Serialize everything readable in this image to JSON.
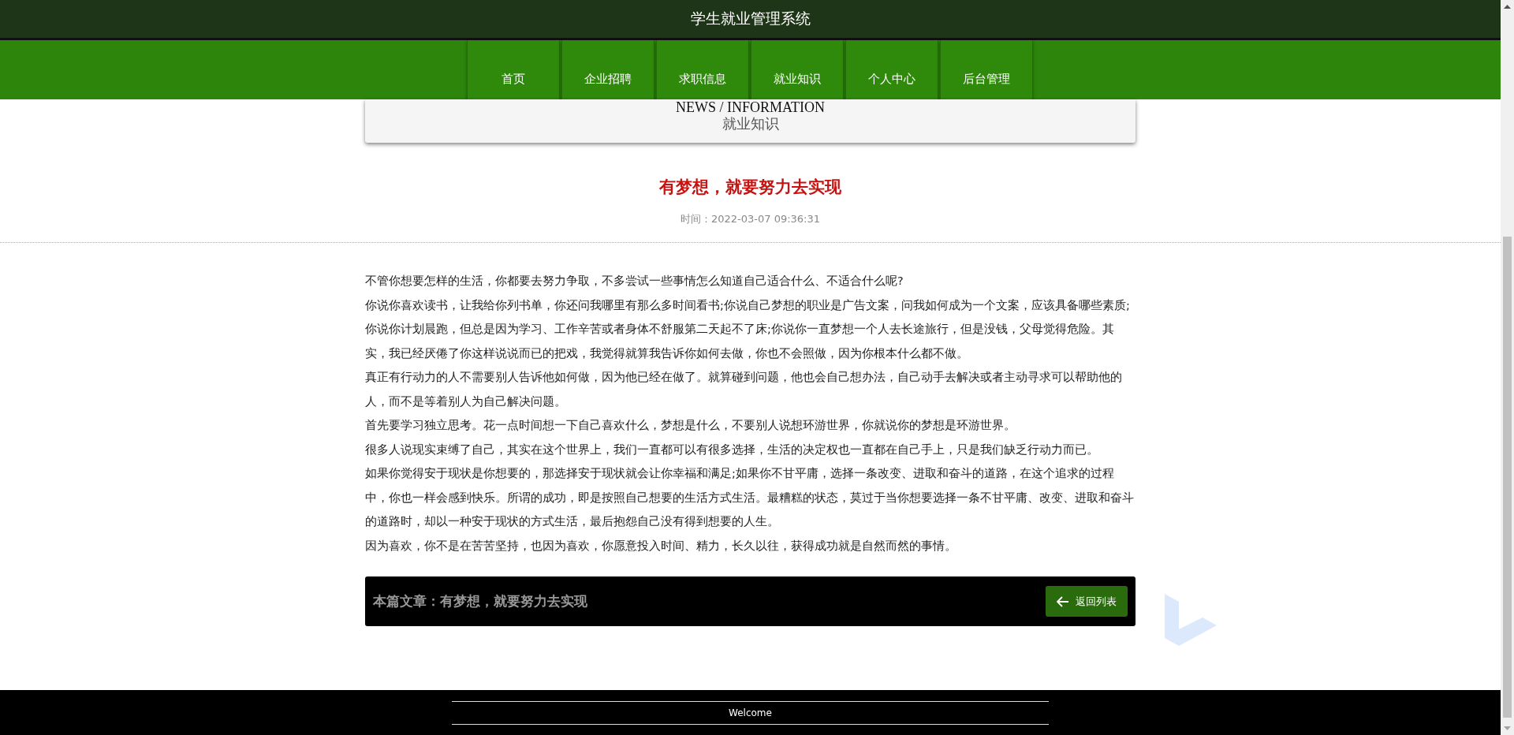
{
  "header": {
    "title": "学生就业管理系统"
  },
  "nav": {
    "items": [
      {
        "label": "首页"
      },
      {
        "label": "企业招聘"
      },
      {
        "label": "求职信息"
      },
      {
        "label": "就业知识"
      },
      {
        "label": "个人中心"
      },
      {
        "label": "后台管理"
      }
    ]
  },
  "section": {
    "heading_en": "NEWS / INFORMATION",
    "heading": "就业知识"
  },
  "article": {
    "title": "有梦想，就要努力去实现",
    "time": "时间：2022-03-07 09:36:31",
    "paragraphs": [
      "不管你想要怎样的生活，你都要去努力争取，不多尝试一些事情怎么知道自己适合什么、不适合什么呢?",
      "你说你喜欢读书，让我给你列书单，你还问我哪里有那么多时间看书;你说自己梦想的职业是广告文案，问我如何成为一个文案，应该具备哪些素质;你说你计划晨跑，但总是因为学习、工作辛苦或者身体不舒服第二天起不了床;你说你一直梦想一个人去长途旅行，但是没钱，父母觉得危险。其实，我已经厌倦了你这样说说而已的把戏，我觉得就算我告诉你如何去做，你也不会照做，因为你根本什么都不做。",
      "真正有行动力的人不需要别人告诉他如何做，因为他已经在做了。就算碰到问题，他也会自己想办法，自己动手去解决或者主动寻求可以帮助他的人，而不是等着别人为自己解决问题。",
      "首先要学习独立思考。花一点时间想一下自己喜欢什么，梦想是什么，不要别人说想环游世界，你就说你的梦想是环游世界。",
      "很多人说现实束缚了自己，其实在这个世界上，我们一直都可以有很多选择，生活的决定权也一直都在自己手上，只是我们缺乏行动力而已。",
      "如果你觉得安于现状是你想要的，那选择安于现状就会让你幸福和满足;如果你不甘平庸，选择一条改变、进取和奋斗的道路，在这个追求的过程中，你也一样会感到快乐。所谓的成功，即是按照自己想要的生活方式生活。最糟糕的状态，莫过于当你想要选择一条不甘平庸、改变、进取和奋斗的道路时，却以一种安于现状的方式生活，最后抱怨自己没有得到想要的人生。",
      "因为喜欢，你不是在苦苦坚持，也因为喜欢，你愿意投入时间、精力，长久以往，获得成功就是自然而然的事情。"
    ]
  },
  "article_bar": {
    "label": "本篇文章：有梦想，就要努力去实现",
    "back_button": "返回列表"
  },
  "footer": {
    "text": "Welcome"
  }
}
